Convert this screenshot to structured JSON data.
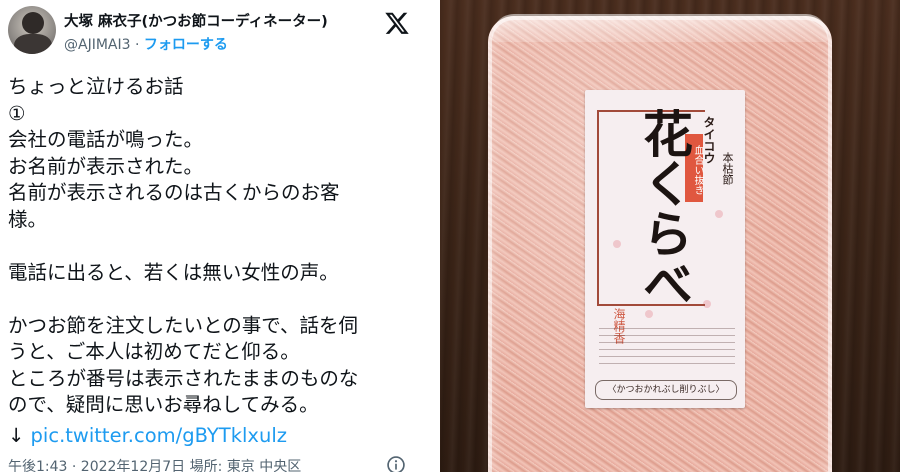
{
  "tweet": {
    "display_name": "大塚 麻衣子(かつお節コーディネーター)",
    "handle": "@AJIMAI3",
    "separator": " · ",
    "follow_label": "フォローする",
    "platform_icon": "x-logo-icon",
    "lines": [
      "ちょっと泣けるお話",
      "①",
      "会社の電話が鳴った。",
      "お名前が表示された。",
      "名前が表示されるのは古くからのお客",
      "様。",
      "",
      "電話に出ると、若くは無い女性の声。",
      "",
      "かつお節を注文したいとの事で、話を伺",
      "うと、ご本人は初めてだと仰る。",
      "ところが番号は表示されたままのものな",
      "ので、疑問に思いお尋ねしてみる。"
    ],
    "link_arrow": "↓",
    "link_text": "pic.twitter.com/gBYTklxulz",
    "timestamp_location": "午後1:43 · 2022年12月7日 場所: 東京 中央区",
    "info_icon": "info-icon",
    "accent_color": "#1d9bf0"
  },
  "photo": {
    "label_brand": "タイコウ",
    "label_subbrand": "本枯節",
    "label_red_tag": "血合い抜き",
    "label_product": "花くらべ",
    "label_stamp": "海精香",
    "label_footer": "〈かつおかれぶし削りぶし〉"
  }
}
